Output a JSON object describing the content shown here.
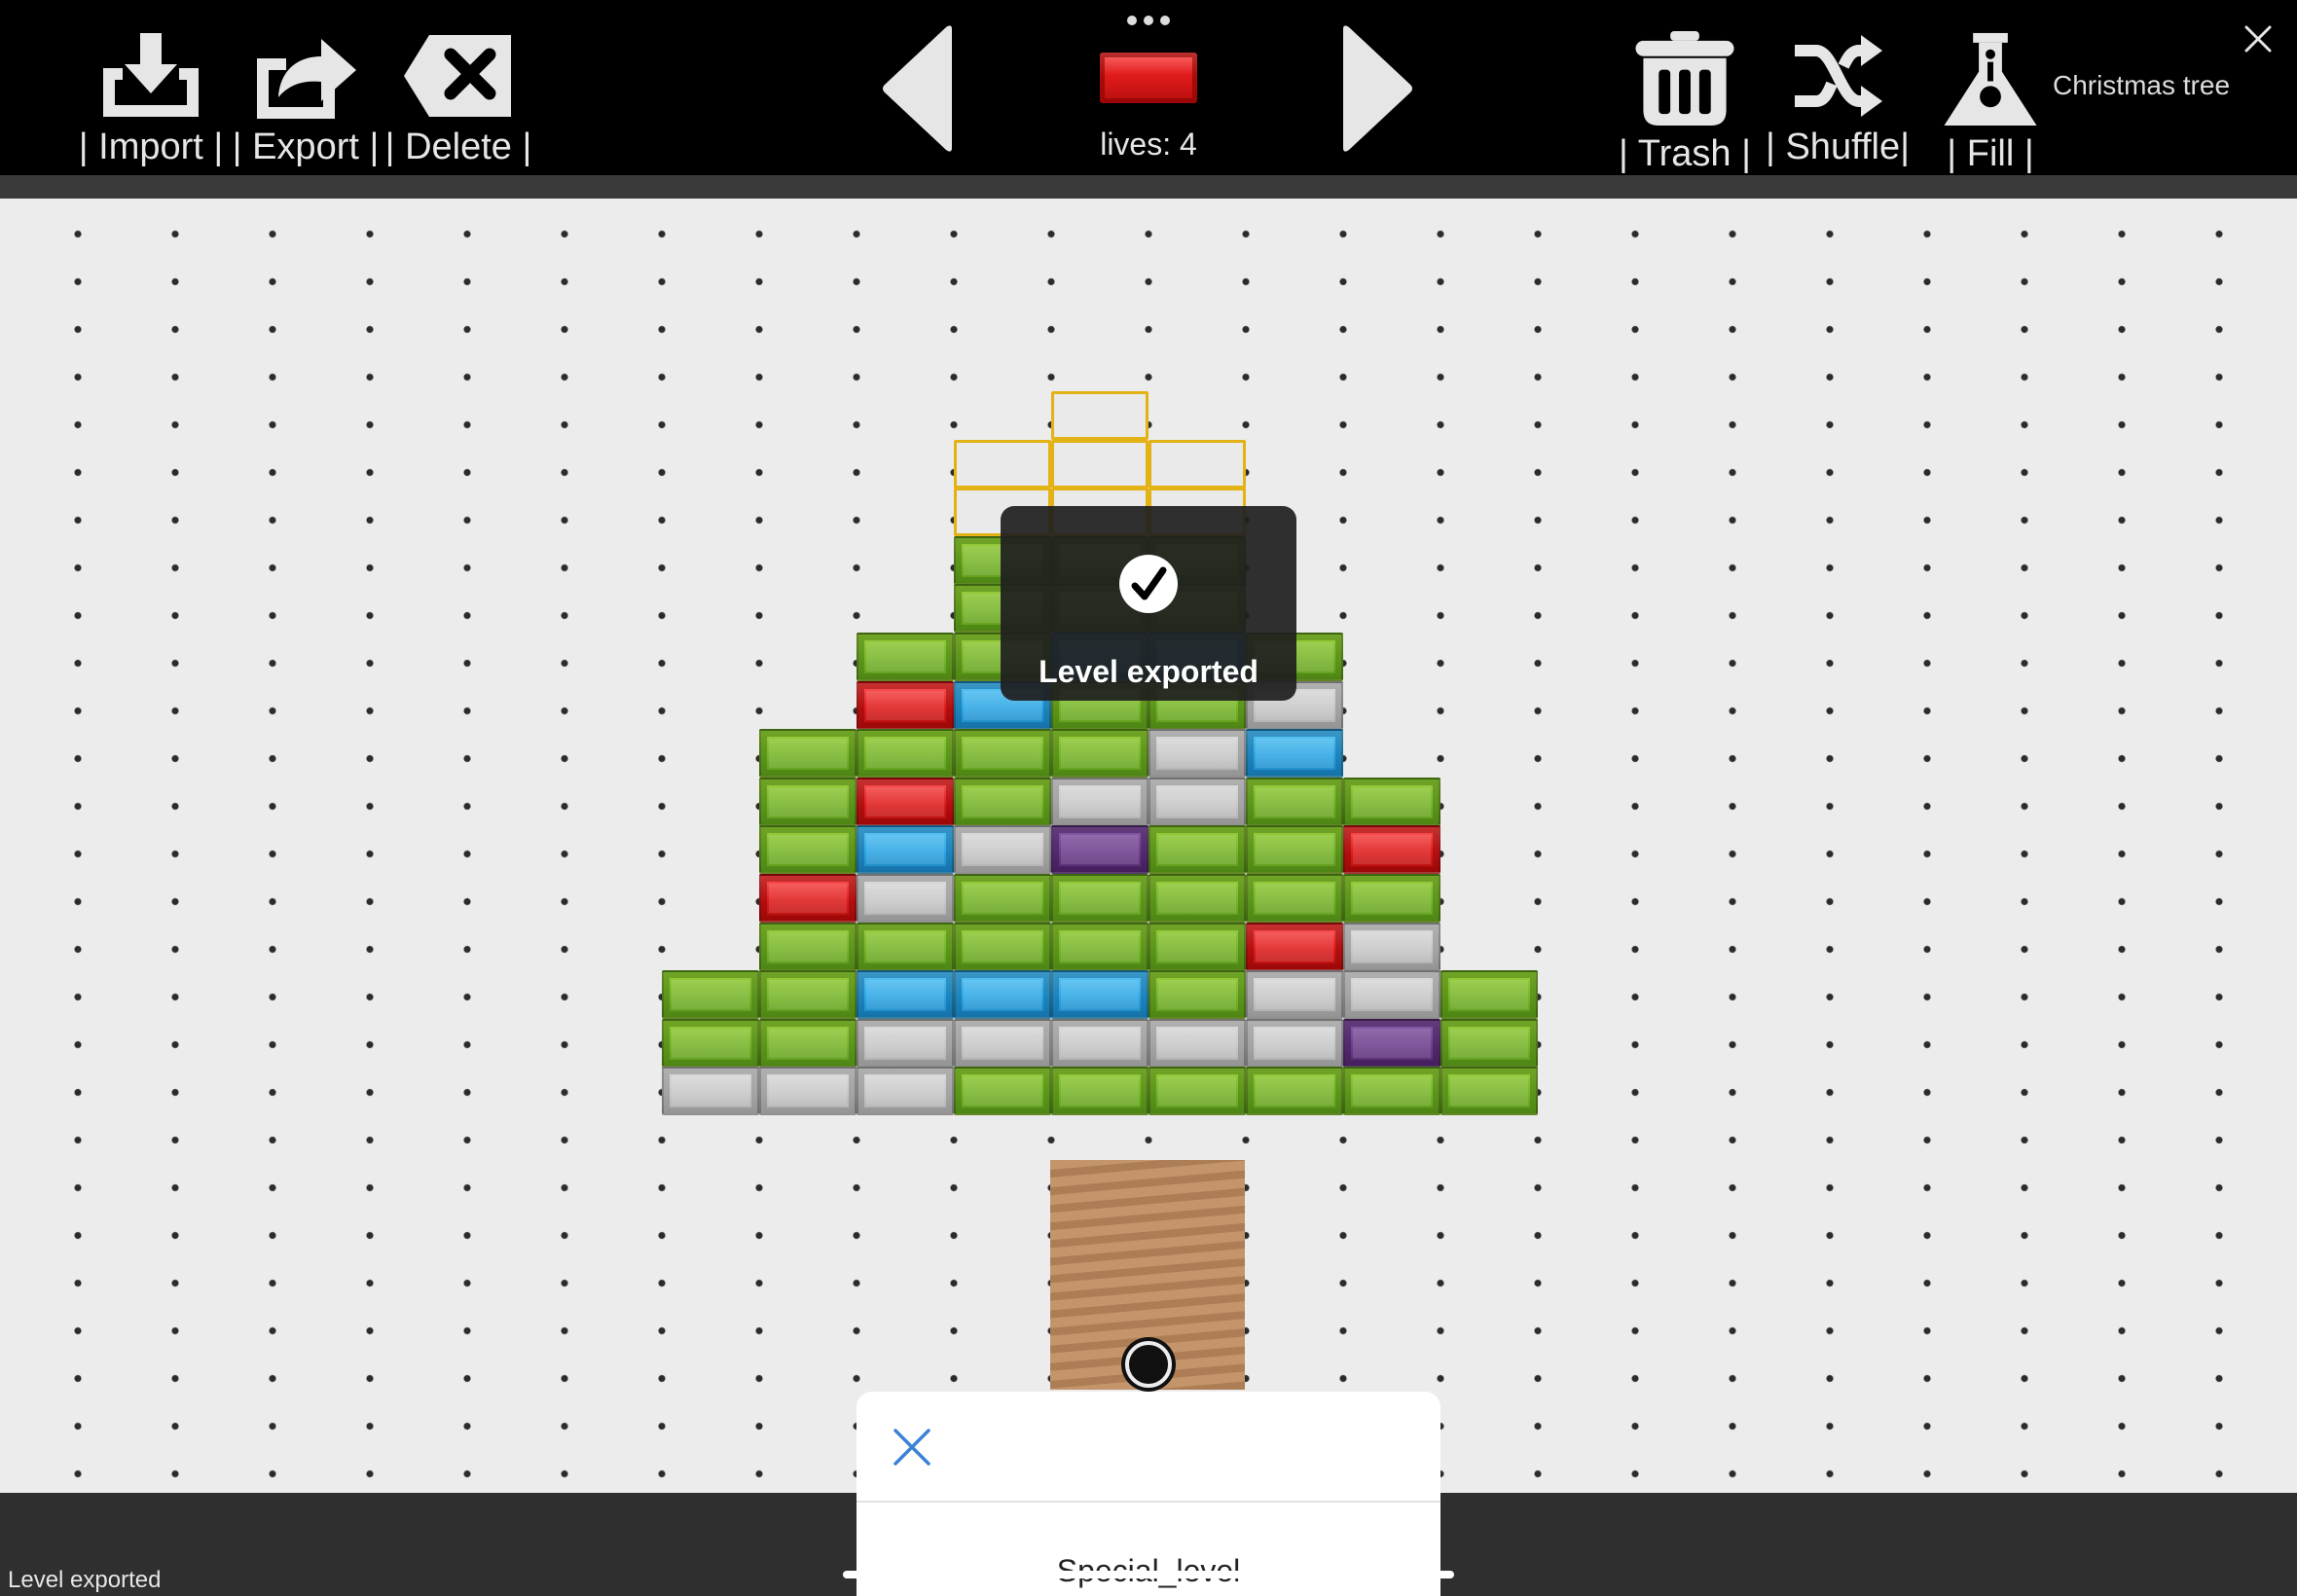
{
  "toolbar": {
    "left_tools": [
      {
        "icon": "import-icon",
        "label": "| Import |"
      },
      {
        "icon": "export-icon",
        "label": "| Export |"
      },
      {
        "icon": "delete-icon",
        "label": "| Delete |"
      }
    ],
    "right_tools": [
      {
        "icon": "trash-icon",
        "label": "| Trash |"
      },
      {
        "icon": "shuffle-icon",
        "label": "| Shuffle|"
      },
      {
        "icon": "flask-icon",
        "label": "|  Fill  |"
      }
    ],
    "lives_text": "lives: 4",
    "level_name": "Christmas tree",
    "selected_brick_color": "#e01b1b"
  },
  "board": {
    "background": "#ececec",
    "brick_colors": {
      "G": "#77b52a",
      "S": "#c8c8c8",
      "R": "#de1d1d",
      "B": "#2ea6e4",
      "P": "#6d3f8c",
      "W": "#eaeaea"
    },
    "rows": [
      "...W...",
      "..WWW..",
      "..WWW..",
      "..GGG..",
      "..GGG..",
      ".GGBBG.",
      ".RBGGS.",
      "GGGGSB.",
      "GRGSSGG",
      "GBSPGGR",
      "RSGGGGG",
      "GGGGGRS",
      "GGBBBGSSG",
      "GGSSSSSPG",
      "SSSGGGGGG"
    ]
  },
  "toast": {
    "message": "Level exported"
  },
  "sheet": {
    "item": "Special_level"
  },
  "status_text": "Level exported"
}
